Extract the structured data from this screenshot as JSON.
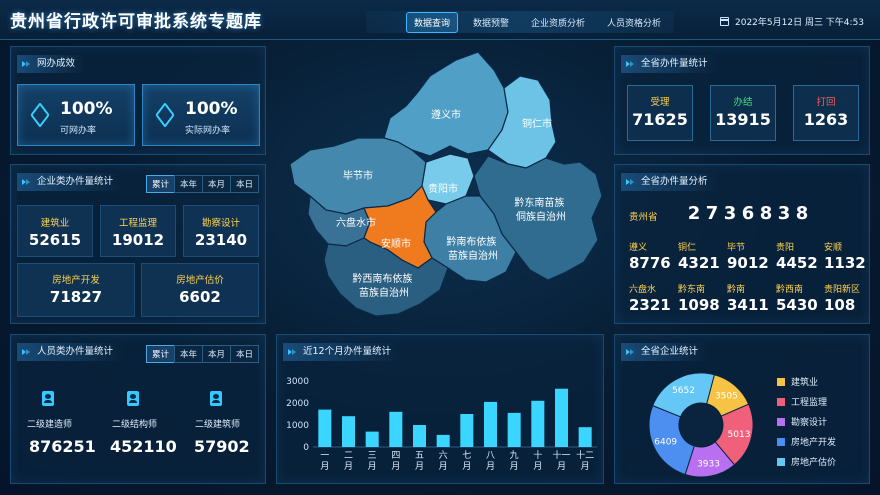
{
  "header": {
    "title": "贵州省行政许可审批系统专题库",
    "nav": [
      {
        "label": "数据查询",
        "active": true
      },
      {
        "label": "数据预警",
        "active": false
      },
      {
        "label": "企业资质分析",
        "active": false
      },
      {
        "label": "人员资格分析",
        "active": false
      }
    ],
    "datetime": "2022年5月12日 周三 下午4:53"
  },
  "online_effect": {
    "title": "网办成效",
    "cards": [
      {
        "value": "100%",
        "label": "可网办率",
        "icon": "cube-icon"
      },
      {
        "value": "100%",
        "label": "实际网办率",
        "icon": "cube-icon"
      }
    ]
  },
  "enterprise_stats": {
    "title": "企业类办件量统计",
    "tabs": [
      "累计",
      "本年",
      "本月",
      "本日"
    ],
    "items": [
      {
        "label": "建筑业",
        "value": "52615"
      },
      {
        "label": "工程监理",
        "value": "19012"
      },
      {
        "label": "勘察设计",
        "value": "23140"
      },
      {
        "label": "房地产开发",
        "value": "71827"
      },
      {
        "label": "房地产估价",
        "value": "6602"
      }
    ]
  },
  "personnel_stats": {
    "title": "人员类办件量统计",
    "tabs": [
      "累计",
      "本年",
      "本月",
      "本日"
    ],
    "items": [
      {
        "label": "二级建造师",
        "value": "876251",
        "icon": "person-id-icon"
      },
      {
        "label": "二级结构师",
        "value": "452110",
        "icon": "person-id-icon"
      },
      {
        "label": "二级建筑师",
        "value": "57902",
        "icon": "person-id-icon"
      }
    ]
  },
  "map": {
    "regions": [
      {
        "label": "遵义市"
      },
      {
        "label": "铜仁市"
      },
      {
        "label": "毕节市"
      },
      {
        "label": "贵阳市"
      },
      {
        "label": "六盘水市"
      },
      {
        "label": "安顺市"
      },
      {
        "label": "黔东南苗族侗族自治州"
      },
      {
        "label": "黔南布依族苗族自治州"
      },
      {
        "label": "黔西南布依族苗族自治州"
      }
    ],
    "highlighted": "安顺市",
    "colors": {
      "highlight": "#f07a1e",
      "light": "#5fb5d8",
      "mid": "#4588ad",
      "dark": "#2c5f80"
    }
  },
  "province_volume": {
    "title": "全省办件量统计",
    "cards": [
      {
        "label": "受理",
        "value": "71625",
        "color": "#ffd34e"
      },
      {
        "label": "办结",
        "value": "13915",
        "color": "#3fe07a"
      },
      {
        "label": "打回",
        "value": "1263",
        "color": "#ff5a5a"
      }
    ]
  },
  "province_analysis": {
    "title": "全省办件量分析",
    "total_label": "贵州省",
    "total_digits": [
      "2",
      "7",
      "3",
      "6",
      "8",
      "3",
      "8"
    ],
    "regions": [
      {
        "label": "遵义",
        "value": "8776"
      },
      {
        "label": "铜仁",
        "value": "4321"
      },
      {
        "label": "毕节",
        "value": "9012"
      },
      {
        "label": "贵阳",
        "value": "4452"
      },
      {
        "label": "安顺",
        "value": "1132"
      },
      {
        "label": "六盘水",
        "value": "2321"
      },
      {
        "label": "黔东南",
        "value": "1098"
      },
      {
        "label": "黔南",
        "value": "3411"
      },
      {
        "label": "黔西南",
        "value": "5430"
      },
      {
        "label": "贵阳新区",
        "value": "108"
      }
    ]
  },
  "monthly_chart": {
    "title": "近12个月办件量统计"
  },
  "enterprise_total": {
    "title": "全省企业统计"
  },
  "chart_data": [
    {
      "type": "bar",
      "categories": [
        "一月",
        "二月",
        "三月",
        "四月",
        "五月",
        "六月",
        "七月",
        "八月",
        "九月",
        "十月",
        "十一月",
        "十二月"
      ],
      "values": [
        1700,
        1400,
        700,
        1600,
        1000,
        550,
        1500,
        2050,
        1550,
        2100,
        2650,
        900
      ],
      "ylim": [
        0,
        3000
      ],
      "yticks": [
        0,
        1000,
        2000,
        3000
      ],
      "grid": false,
      "bar_color": "#3ad6ff"
    },
    {
      "type": "pie",
      "donut": true,
      "categories": [
        "建筑业",
        "工程监理",
        "勘察设计",
        "房地产开发",
        "房地产估价"
      ],
      "values": [
        3505,
        5013,
        3933,
        6409,
        5652
      ],
      "colors": [
        "#f6c344",
        "#f0607a",
        "#b86ff0",
        "#4d8ff0",
        "#64c7f5"
      ],
      "legend": "right"
    }
  ]
}
